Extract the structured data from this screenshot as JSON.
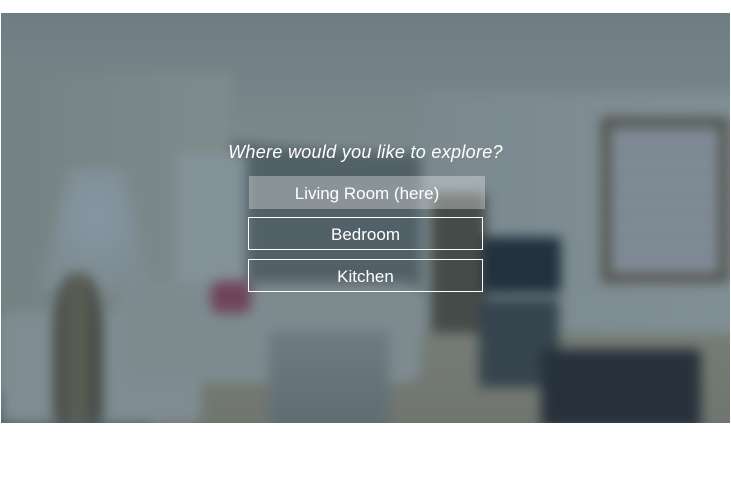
{
  "prompt": "Where would you like to explore?",
  "choices": [
    {
      "label": "Living Room (here)",
      "current": true
    },
    {
      "label": "Bedroom",
      "current": false
    },
    {
      "label": "Kitchen",
      "current": false
    }
  ],
  "colors": {
    "overlay": "#244056",
    "text": "#ffffff",
    "highlight": "#ffffff"
  }
}
